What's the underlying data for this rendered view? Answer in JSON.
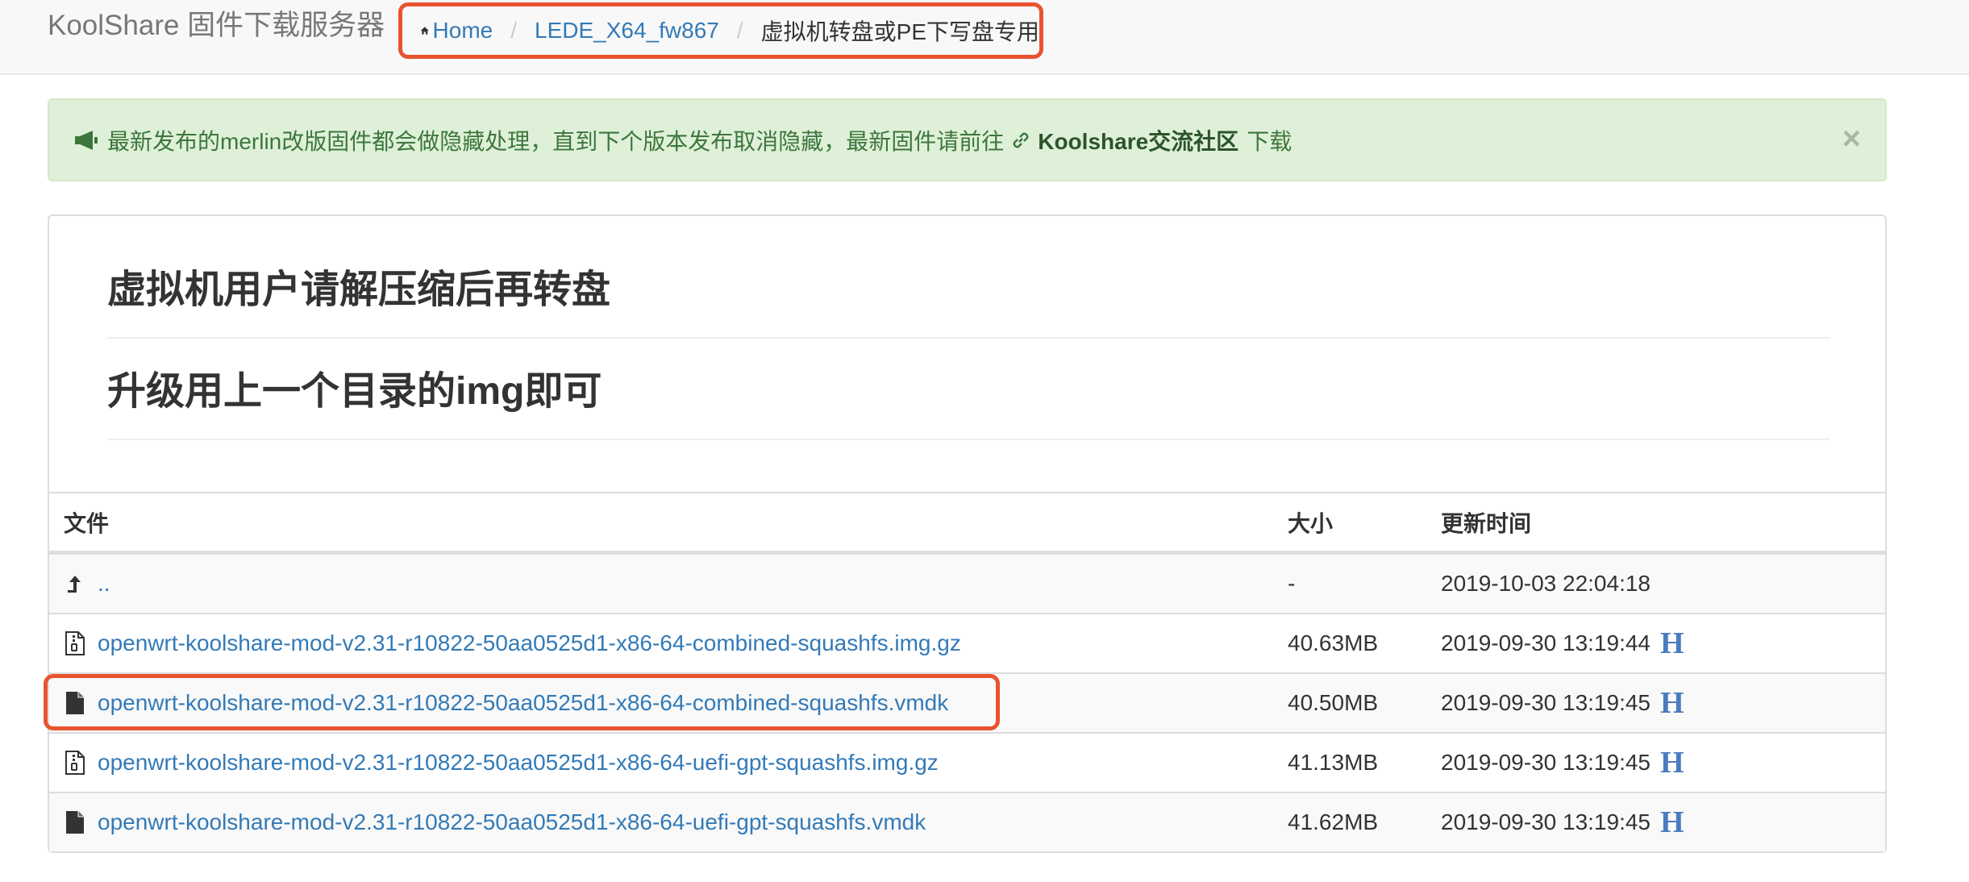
{
  "navbar": {
    "brand": "KoolShare 固件下载服务器",
    "breadcrumb": [
      "Home",
      "LEDE_X64_fw867",
      "虚拟机转盘或PE下写盘专用"
    ],
    "separator": "/"
  },
  "alert": {
    "text_before": "最新发布的merlin改版固件都会做隐藏处理，直到下个版本发布取消隐藏，最新固件请前往",
    "link_text": "Koolshare交流社区",
    "text_after": "下载",
    "close": "×"
  },
  "panel": {
    "heading1": "虚拟机用户请解压缩后再转盘",
    "heading2": "升级用上一个目录的img即可"
  },
  "table": {
    "columns": [
      "文件",
      "大小",
      "更新时间"
    ],
    "parent": {
      "name": "..",
      "size": "-",
      "time": "2019-10-03 22:04:18"
    },
    "rows": [
      {
        "name": "openwrt-koolshare-mod-v2.31-r10822-50aa0525d1-x86-64-combined-squashfs.img.gz",
        "size": "40.63MB",
        "time": "2019-09-30 13:19:44",
        "mark": "H",
        "icon": "archive-file-icon"
      },
      {
        "name": "openwrt-koolshare-mod-v2.31-r10822-50aa0525d1-x86-64-combined-squashfs.vmdk",
        "size": "40.50MB",
        "time": "2019-09-30 13:19:45",
        "mark": "H",
        "icon": "file-icon"
      },
      {
        "name": "openwrt-koolshare-mod-v2.31-r10822-50aa0525d1-x86-64-uefi-gpt-squashfs.img.gz",
        "size": "41.13MB",
        "time": "2019-09-30 13:19:45",
        "mark": "H",
        "icon": "archive-file-icon"
      },
      {
        "name": "openwrt-koolshare-mod-v2.31-r10822-50aa0525d1-x86-64-uefi-gpt-squashfs.vmdk",
        "size": "41.62MB",
        "time": "2019-09-30 13:19:45",
        "mark": "H",
        "icon": "file-icon"
      }
    ]
  },
  "colors": {
    "link": "#337ab7",
    "alert_bg": "#dff0d8",
    "alert_text": "#3c763d",
    "highlight": "#e8532f"
  }
}
